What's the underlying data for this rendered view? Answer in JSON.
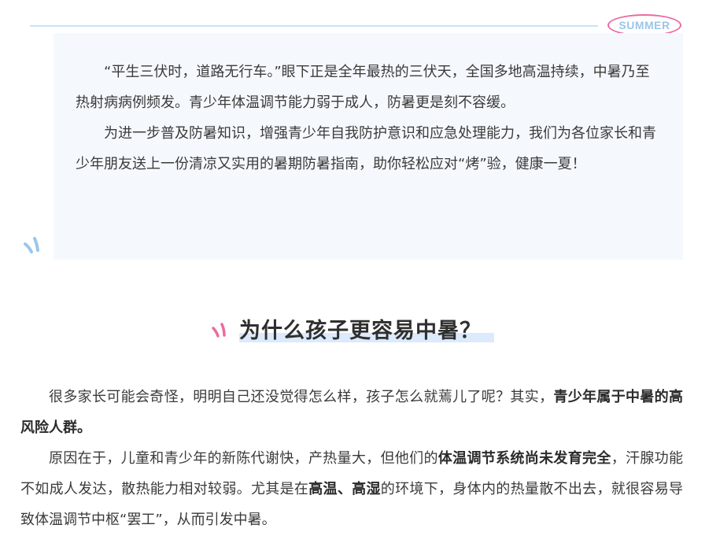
{
  "badge": {
    "label": "SUMMER"
  },
  "intro": {
    "p1": "“平生三伏时，道路无行车。”眼下正是全年最热的三伏天，全国多地高温持续，中暑乃至热射病病例频发。青少年体温调节能力弱于成人，防暑更是刻不容缓。",
    "p2": "为进一步普及防暑知识，增强青少年自我防护意识和应急处理能力，我们为各位家长和青少年朋友送上一份清凉又实用的暑期防暑指南，助你轻松应对“烤”验，健康一夏！"
  },
  "section": {
    "title": "为什么孩子更容易中暑？"
  },
  "body": {
    "p1_a": "很多家长可能会奇怪，明明自己还没觉得怎么样，孩子怎么就蔫儿了呢？其实，",
    "p1_b": "青少年属于中暑的高风险人群。",
    "p2_a": "原因在于，儿童和青少年的新陈代谢快，产热量大，但他们的",
    "p2_b": "体温调节系统尚未发育完全",
    "p2_c": "，汗腺功能不如成人发达，散热能力相对较弱。尤其是在",
    "p2_d": "高温、高湿",
    "p2_e": "的环境下，身体内的热量散不出去，就很容易导致体温调节中枢“罢工”，从而引发中暑。"
  },
  "colors": {
    "accent_pink": "#ec6aa0",
    "accent_blue": "#9bc6e8",
    "card_bg": "#f5f9fe"
  }
}
